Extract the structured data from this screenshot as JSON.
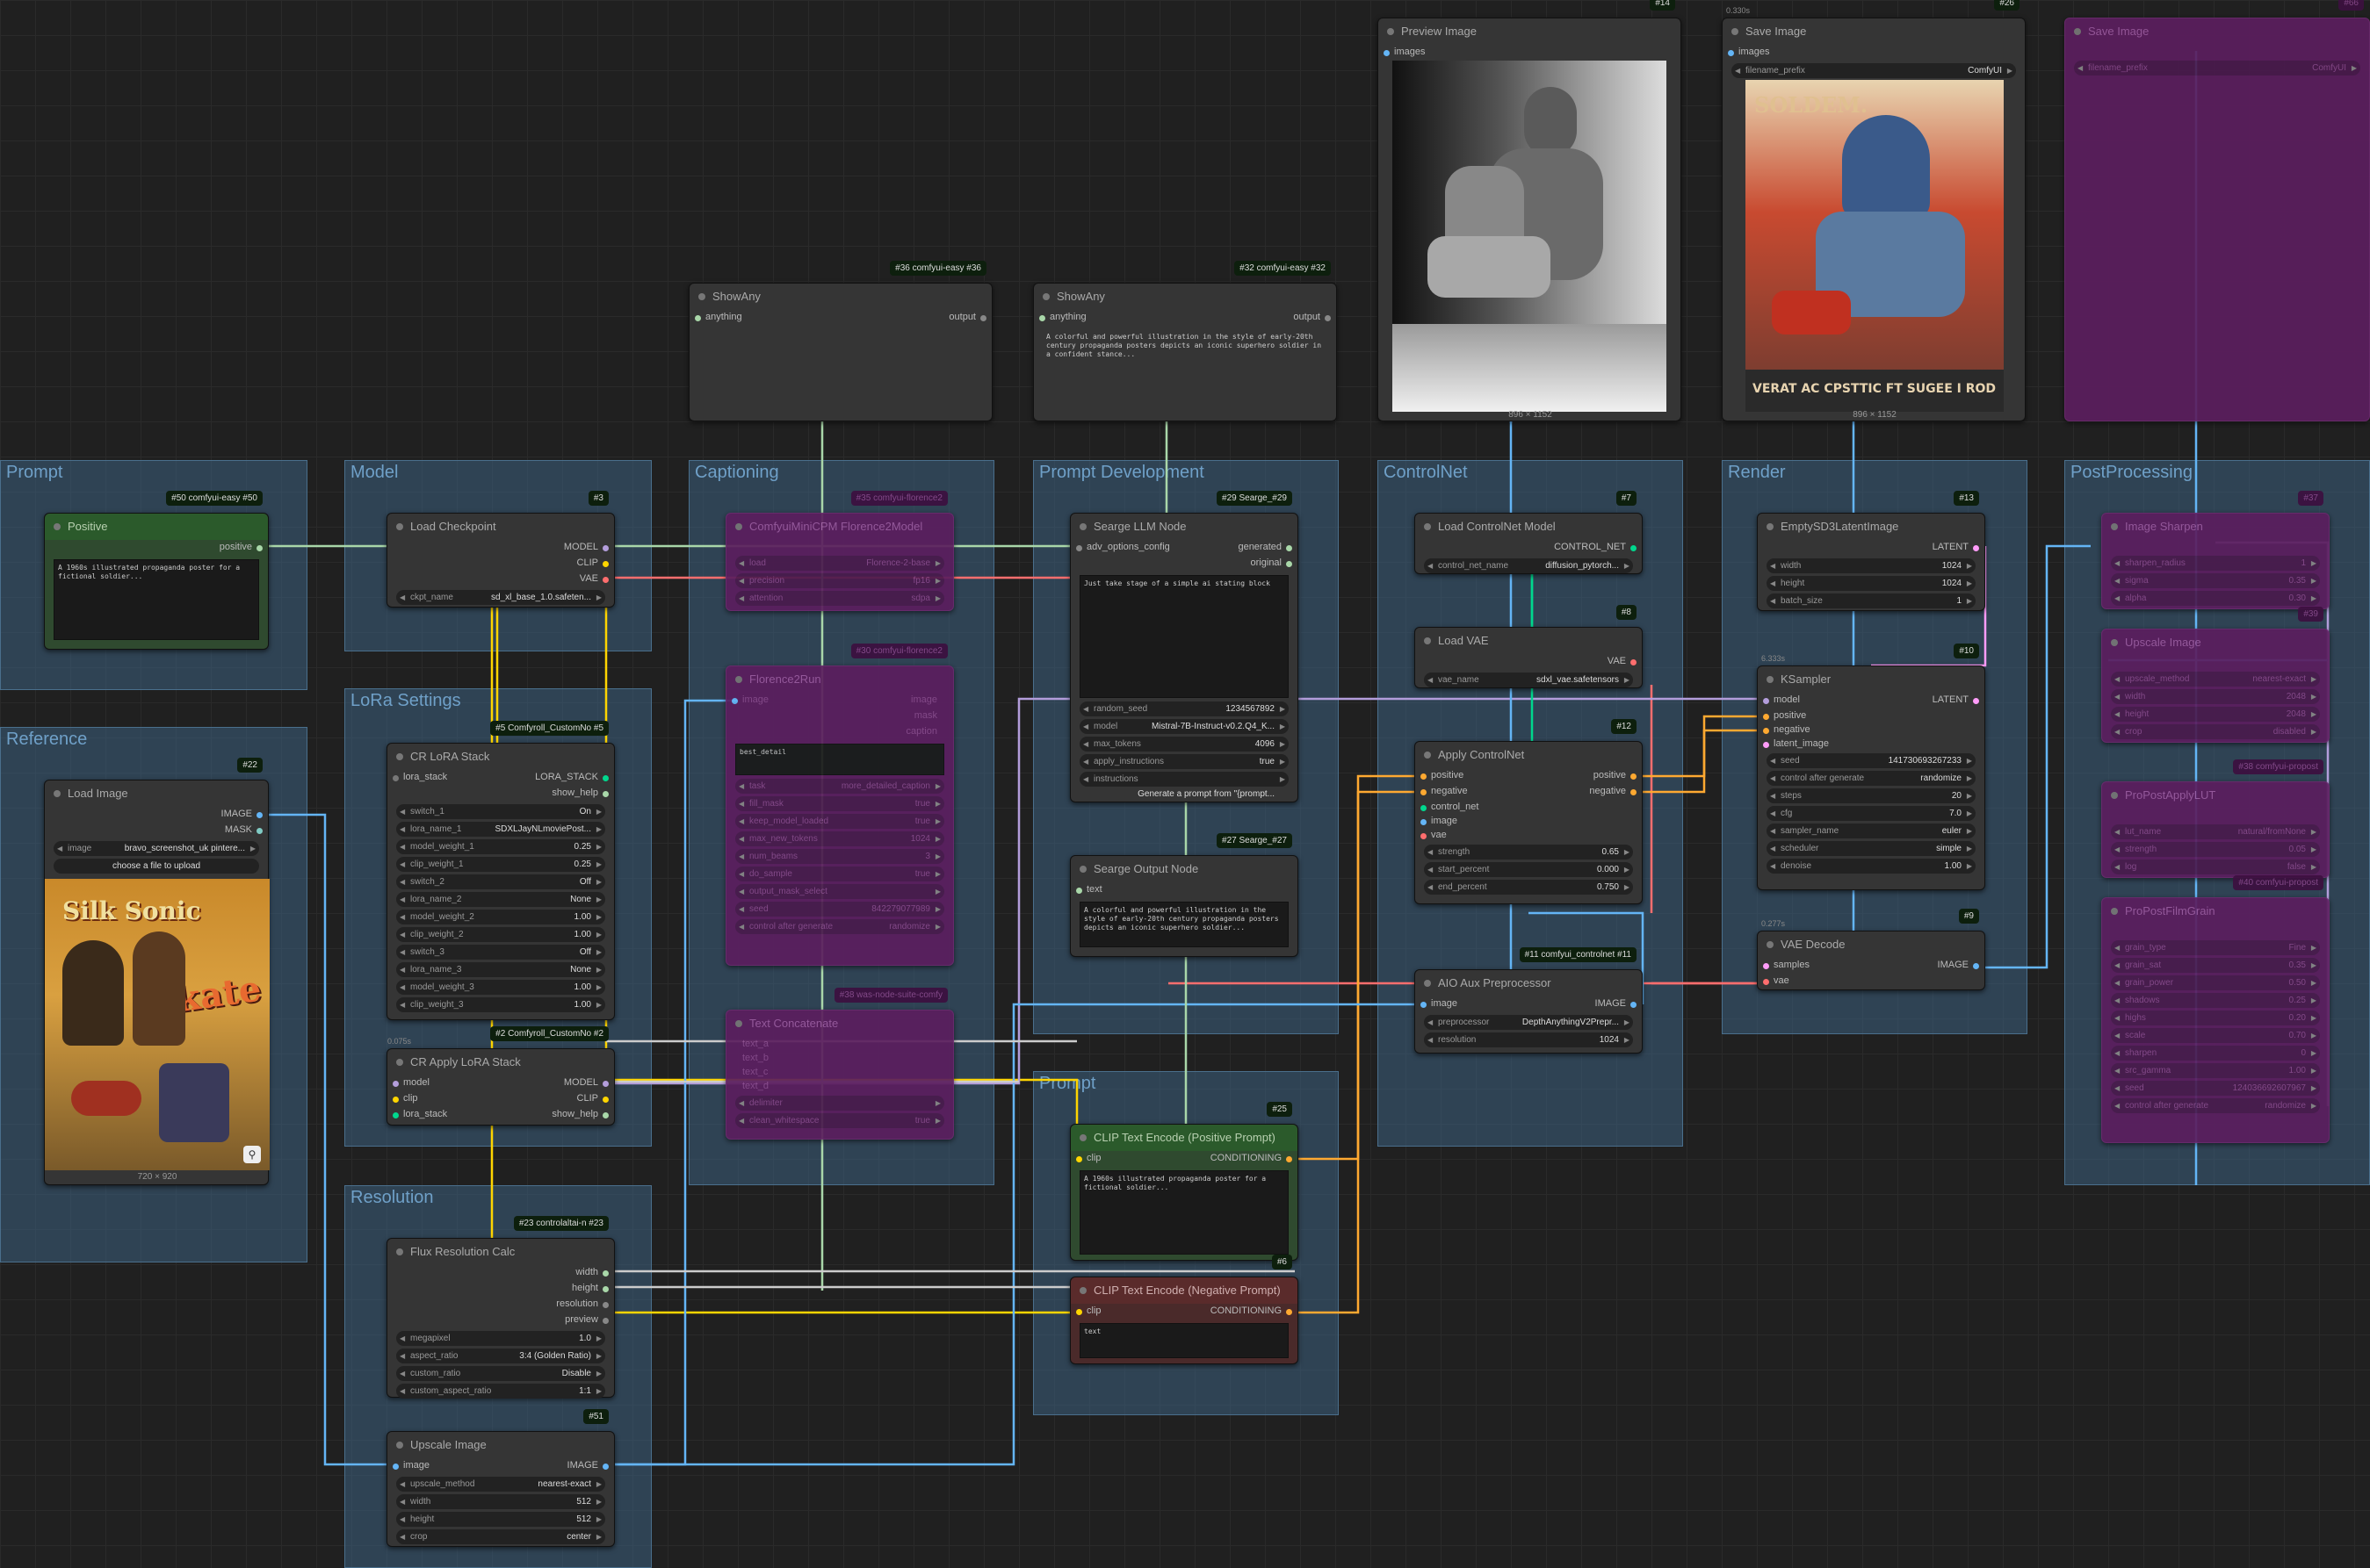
{
  "groups": {
    "prompt": "Prompt",
    "model": "Model",
    "lora": "LoRa Settings",
    "reference": "Reference",
    "resolution": "Resolution",
    "captioning": "Captioning",
    "prompt_dev": "Prompt Development",
    "prompt2": "Prompt",
    "controlnet": "ControlNet",
    "render": "Render",
    "post": "PostProcessing"
  },
  "positive": {
    "title": "Positive",
    "badge": "#50 comfyui-easy #50",
    "out": "positive",
    "text": "A 1960s illustrated propaganda poster for a fictional soldier..."
  },
  "checkpoint": {
    "title": "Load Checkpoint",
    "badge": "#3",
    "o1": "MODEL",
    "o2": "CLIP",
    "o3": "VAE",
    "w_label": "ckpt_name",
    "w_value": "sd_xl_base_1.0.safeten..."
  },
  "lora_stack": {
    "title": "CR LoRA Stack",
    "badge": "#5 Comfyroll_CustomNo #5",
    "in": "lora_stack",
    "o1": "LORA_STACK",
    "o2": "show_help",
    "rows": [
      [
        "switch_1",
        "On"
      ],
      [
        "lora_name_1",
        "SDXLJayNLmoviePost..."
      ],
      [
        "model_weight_1",
        "0.25"
      ],
      [
        "clip_weight_1",
        "0.25"
      ],
      [
        "switch_2",
        "Off"
      ],
      [
        "lora_name_2",
        "None"
      ],
      [
        "model_weight_2",
        "1.00"
      ],
      [
        "clip_weight_2",
        "1.00"
      ],
      [
        "switch_3",
        "Off"
      ],
      [
        "lora_name_3",
        "None"
      ],
      [
        "model_weight_3",
        "1.00"
      ],
      [
        "clip_weight_3",
        "1.00"
      ]
    ]
  },
  "apply_lora": {
    "title": "CR Apply LoRA Stack",
    "badge": "#2 Comfyroll_CustomNo #2",
    "stat": "0.075s",
    "i1": "model",
    "i2": "clip",
    "i3": "lora_stack",
    "o1": "MODEL",
    "o2": "CLIP",
    "o3": "show_help"
  },
  "load_image": {
    "title": "Load Image",
    "badge": "#22",
    "o1": "IMAGE",
    "o2": "MASK",
    "w_label": "image",
    "w_value": "bravo_screenshot_uk pintere...",
    "btn": "choose a file to upload",
    "size": "720 × 920",
    "poster_title": "Silk Sonic",
    "poster_word": "Skate"
  },
  "flux_res": {
    "title": "Flux Resolution Calc",
    "badge": "#23 controlaltai-n #23",
    "o1": "width",
    "o2": "height",
    "o3": "resolution",
    "o4": "preview",
    "rows": [
      [
        "megapixel",
        "1.0"
      ],
      [
        "aspect_ratio",
        "3:4 (Golden Ratio)"
      ],
      [
        "custom_ratio",
        "Disable"
      ],
      [
        "custom_aspect_ratio",
        "1:1"
      ]
    ]
  },
  "upscale": {
    "title": "Upscale Image",
    "badge": "#51",
    "i1": "image",
    "o1": "IMAGE",
    "rows": [
      [
        "upscale_method",
        "nearest-exact"
      ],
      [
        "width",
        "512"
      ],
      [
        "height",
        "512"
      ],
      [
        "crop",
        "center"
      ]
    ]
  },
  "show_any1": {
    "title": "ShowAny",
    "badge": "#36 comfyui-easy #36",
    "in": "anything",
    "out": "output"
  },
  "show_any2": {
    "title": "ShowAny",
    "badge": "#32 comfyui-easy #32",
    "in": "anything",
    "out": "output",
    "text": "A colorful and powerful illustration in the style of early-20th century propaganda posters depicts an iconic superhero soldier in a confident stance..."
  },
  "florence": {
    "title": "ComfyuiMiniCPM Florence2Model",
    "badge": "#35 comfyui-florence2",
    "rows": [
      [
        "load",
        "Florence-2-base"
      ],
      [
        "precision",
        "fp16"
      ],
      [
        "attention",
        "sdpa"
      ]
    ]
  },
  "florence_run": {
    "title": "Florence2Run",
    "badge": "#30 comfyui-florence2",
    "i1": "image",
    "o1": "image",
    "o2": "mask",
    "o3": "caption",
    "text": "best_detail",
    "rows": [
      [
        "task",
        "more_detailed_caption"
      ],
      [
        "fill_mask",
        "true"
      ],
      [
        "keep_model_loaded",
        "true"
      ],
      [
        "max_new_tokens",
        "1024"
      ],
      [
        "num_beams",
        "3"
      ],
      [
        "do_sample",
        "true"
      ],
      [
        "output_mask_select",
        ""
      ],
      [
        "seed",
        "842279077989"
      ],
      [
        "control after generate",
        "randomize"
      ]
    ]
  },
  "text_concat": {
    "title": "Text Concatenate",
    "badge": "#38 was-node-suite-comfy",
    "rows": [
      [
        "delimiter",
        ""
      ],
      [
        "clean_whitespace",
        "true"
      ]
    ],
    "ins": [
      "text_a",
      "text_b",
      "text_c",
      "text_d"
    ]
  },
  "searge_llm": {
    "title": "Searge LLM Node",
    "badge": "#29 Searge_#29",
    "in": "adv_options_config",
    "o1": "generated",
    "o2": "original",
    "text": "Just take stage of a simple ai stating block",
    "rows": [
      [
        "random_seed",
        "1234567892"
      ],
      [
        "model",
        "Mistral-7B-Instruct-v0.2.Q4_K..."
      ],
      [
        "max_tokens",
        "4096"
      ],
      [
        "apply_instructions",
        "true"
      ],
      [
        "instructions",
        "Generate a prompt from \"{prompt..."
      ]
    ]
  },
  "searge_out": {
    "title": "Searge Output Node",
    "badge": "#27 Searge_#27",
    "in": "text",
    "text": "A colorful and powerful illustration in the style of early-20th century propaganda posters depicts an iconic superhero soldier..."
  },
  "clip_pos": {
    "title": "CLIP Text Encode (Positive Prompt)",
    "badge": "#25",
    "in": "clip",
    "out": "CONDITIONING",
    "text": "A 1960s illustrated propaganda poster for a fictional soldier..."
  },
  "clip_neg": {
    "title": "CLIP Text Encode (Negative Prompt)",
    "badge": "#6",
    "in": "clip",
    "out": "CONDITIONING",
    "text": "text"
  },
  "preview": {
    "title": "Preview Image",
    "badge": "#14",
    "in": "images",
    "size": "896 × 1152"
  },
  "save": {
    "title": "Save Image",
    "badge": "#26",
    "stat": "0.330s",
    "in": "images",
    "w_label": "filename_prefix",
    "w_value": "ComfyUI",
    "size": "896 × 1152",
    "poster_top": "SOLDEM.",
    "poster_bottom": "VERAT AC CPSTTIC FT SUGEE I ROD"
  },
  "save2": {
    "title": "Save Image",
    "badge": "#66",
    "w_label": "filename_prefix",
    "w_value": "ComfyUI"
  },
  "controlnet_loader": {
    "title": "Load ControlNet Model",
    "badge": "#7",
    "out": "CONTROL_NET",
    "w_label": "control_net_name",
    "w_value": "diffusion_pytorch..."
  },
  "load_vae": {
    "title": "Load VAE",
    "badge": "#8",
    "out": "VAE",
    "w_label": "vae_name",
    "w_value": "sdxl_vae.safetensors"
  },
  "apply_cn": {
    "title": "Apply ControlNet",
    "badge": "#12",
    "i": [
      "positive",
      "negative",
      "control_net",
      "image",
      "vae"
    ],
    "o1": "positive",
    "o2": "negative",
    "rows": [
      [
        "strength",
        "0.65"
      ],
      [
        "start_percent",
        "0.000"
      ],
      [
        "end_percent",
        "0.750"
      ]
    ]
  },
  "aio": {
    "title": "AIO Aux Preprocessor",
    "badge": "#11 comfyui_controlnet #11",
    "i1": "image",
    "o1": "IMAGE",
    "rows": [
      [
        "preprocessor",
        "DepthAnythingV2Prepr..."
      ],
      [
        "resolution",
        "1024"
      ]
    ]
  },
  "empty_latent": {
    "title": "EmptySD3LatentImage",
    "badge": "#13",
    "out": "LATENT",
    "rows": [
      [
        "width",
        "1024"
      ],
      [
        "height",
        "1024"
      ],
      [
        "batch_size",
        "1"
      ]
    ]
  },
  "ksampler": {
    "title": "KSampler",
    "badge": "#10",
    "stat": "6.333s",
    "i": [
      "model",
      "positive",
      "negative",
      "latent_image"
    ],
    "out": "LATENT",
    "rows": [
      [
        "seed",
        "141730693267233"
      ],
      [
        "control after generate",
        "randomize"
      ],
      [
        "steps",
        "20"
      ],
      [
        "cfg",
        "7.0"
      ],
      [
        "sampler_name",
        "euler"
      ],
      [
        "scheduler",
        "simple"
      ],
      [
        "denoise",
        "1.00"
      ]
    ]
  },
  "vae_decode": {
    "title": "VAE Decode",
    "badge": "#9",
    "stat": "0.277s",
    "i1": "samples",
    "i2": "vae",
    "out": "IMAGE"
  },
  "img_sharpen": {
    "title": "Image Sharpen",
    "badge": "#37",
    "rows": [
      [
        "sharpen_radius",
        "1"
      ],
      [
        "sigma",
        "0.35"
      ],
      [
        "alpha",
        "0.30"
      ]
    ]
  },
  "upscale_img": {
    "title": "Upscale Image",
    "badge": "#39",
    "rows": [
      [
        "upscale_method",
        "nearest-exact"
      ],
      [
        "width",
        "2048"
      ],
      [
        "height",
        "2048"
      ],
      [
        "crop",
        "disabled"
      ]
    ]
  },
  "pp1": {
    "title": "ProPostApplyLUT",
    "badge": "#38 comfyui-propost",
    "rows": [
      [
        "lut_name",
        "natural/fromNone"
      ],
      [
        "strength",
        "0.05"
      ],
      [
        "log",
        "false"
      ]
    ]
  },
  "pp2": {
    "title": "ProPostFilmGrain",
    "badge": "#40 comfyui-propost",
    "rows": [
      [
        "grain_type",
        "Fine"
      ],
      [
        "grain_sat",
        "0.35"
      ],
      [
        "grain_power",
        "0.50"
      ],
      [
        "shadows",
        "0.25"
      ],
      [
        "highs",
        "0.20"
      ],
      [
        "scale",
        "0.70"
      ],
      [
        "sharpen",
        "0"
      ],
      [
        "src_gamma",
        "1.00"
      ],
      [
        "seed",
        "124036692607967"
      ],
      [
        "control after generate",
        "randomize"
      ]
    ]
  },
  "colors": {
    "model": "#b39ddb",
    "clip": "#ffd500",
    "vae": "#ff6e6e",
    "conditioning": "#ffa931",
    "latent": "#ff9cf9",
    "image": "#64b5f6",
    "string": "#a9d7a9",
    "control": "#00d78d"
  }
}
